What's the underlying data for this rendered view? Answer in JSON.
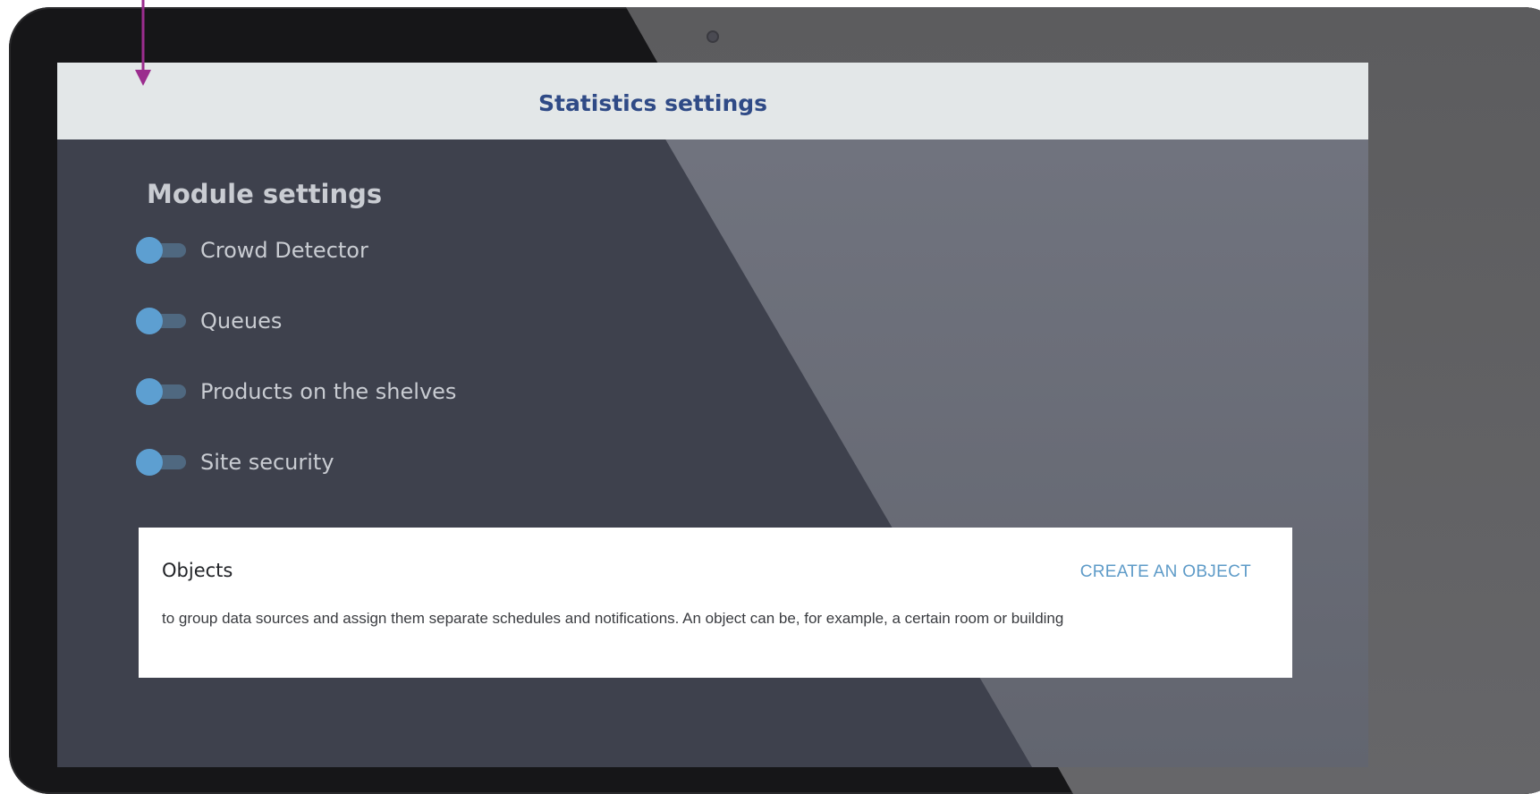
{
  "header": {
    "title": "Statistics settings"
  },
  "module_settings": {
    "title": "Module settings",
    "items": [
      {
        "label": "Crowd Detector"
      },
      {
        "label": "Queues"
      },
      {
        "label": "Products on the shelves"
      },
      {
        "label": "Site security"
      }
    ]
  },
  "objects": {
    "title": "Objects",
    "create_label": "CREATE AN OBJECT",
    "description": "to group data sources and assign them separate schedules and notifications. An object can be, for example, a certain room or building"
  },
  "colors": {
    "accent": "#5e9bc8",
    "header_title": "#2f4a86",
    "annotation_arrow": "#9b2d8e",
    "screen_bg": "#3e414d"
  },
  "icons": {
    "annotation": "arrow-down-icon",
    "camera": "camera-icon"
  }
}
